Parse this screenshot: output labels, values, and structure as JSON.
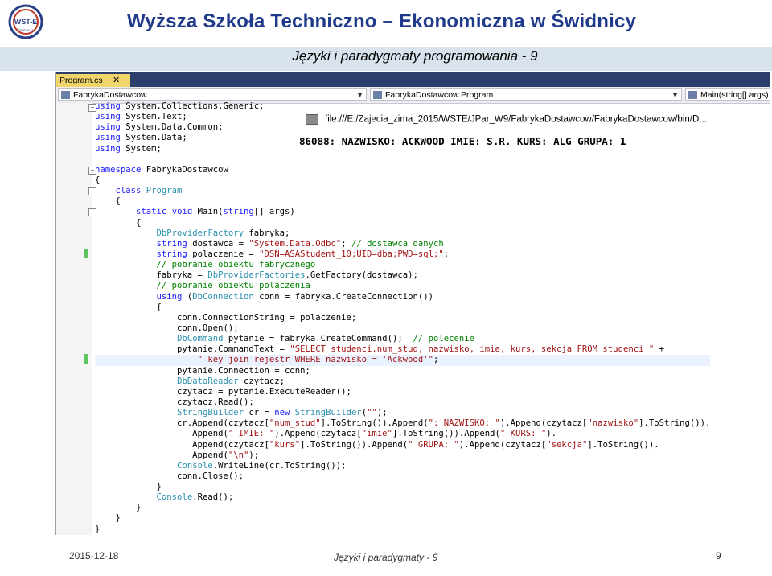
{
  "header": {
    "logo_text": "WST-E",
    "logo_sub": "ŚWIDNICA",
    "school_name": "Wyższa Szkoła Techniczno – Ekonomiczna w Świdnicy",
    "subtitle": "Języki i paradygmaty programowania - 9"
  },
  "ide": {
    "tab_label": "Program.cs",
    "tab_close": "✕",
    "nav": {
      "project": "FabrykaDostawcow",
      "class": "FabrykaDostawcow.Program",
      "member": "Main(string[] args)"
    }
  },
  "console": {
    "title": "file:///E:/Zajecia_zima_2015/WSTE/JPar_W9/FabrykaDostawcow/FabrykaDostawcow/bin/D...",
    "output": "86088: NAZWISKO: ACKWOOD IMIE: S.R. KURS: ALG GRUPA: 1"
  },
  "code_lines": [
    "using System.Collections.Generic;",
    "using System.Text;",
    "using System.Data.Common;",
    "using System.Data;",
    "using System;",
    "",
    "namespace FabrykaDostawcow",
    "{",
    "    class Program",
    "    {",
    "        static void Main(string[] args)",
    "        {",
    "            DbProviderFactory fabryka;",
    "            string dostawca = \"System.Data.Odbc\"; // dostawca danych",
    "            string polaczenie = \"DSN=ASAStudent_10;UID=dba;PWD=sql;\";",
    "            // pobranie obiektu fabrycznego",
    "            fabryka = DbProviderFactories.GetFactory(dostawca);",
    "            // pobranie obiektu polaczenia",
    "            using (DbConnection conn = fabryka.CreateConnection())",
    "            {",
    "                conn.ConnectionString = polaczenie;",
    "                conn.Open();",
    "                DbCommand pytanie = fabryka.CreateCommand();  // polecenie",
    "                pytanie.CommandText = \"SELECT studenci.num_stud, nazwisko, imie, kurs, sekcja FROM studenci \" +",
    "                    \" key join rejestr WHERE nazwisko = 'Ackwood'\";",
    "                pytanie.Connection = conn;",
    "                DbDataReader czytacz;",
    "                czytacz = pytanie.ExecuteReader();",
    "                czytacz.Read();",
    "                StringBuilder cr = new StringBuilder(\"\");",
    "                cr.Append(czytacz[\"num_stud\"].ToString()).Append(\": NAZWISKO: \").Append(czytacz[\"nazwisko\"].ToString()).",
    "                   Append(\" IMIE: \").Append(czytacz[\"imie\"].ToString()).Append(\" KURS: \").",
    "                   Append(czytacz[\"kurs\"].ToString()).Append(\" GRUPA: \").Append(czytacz[\"sekcja\"].ToString()).",
    "                   Append(\"\\n\");",
    "                Console.WriteLine(cr.ToString());",
    "                conn.Close();",
    "            }",
    "            Console.Read();",
    "        }",
    "    }",
    "}"
  ],
  "footer": {
    "date": "2015-12-18",
    "center": "Języki i paradygmaty - 9",
    "page": "9"
  }
}
